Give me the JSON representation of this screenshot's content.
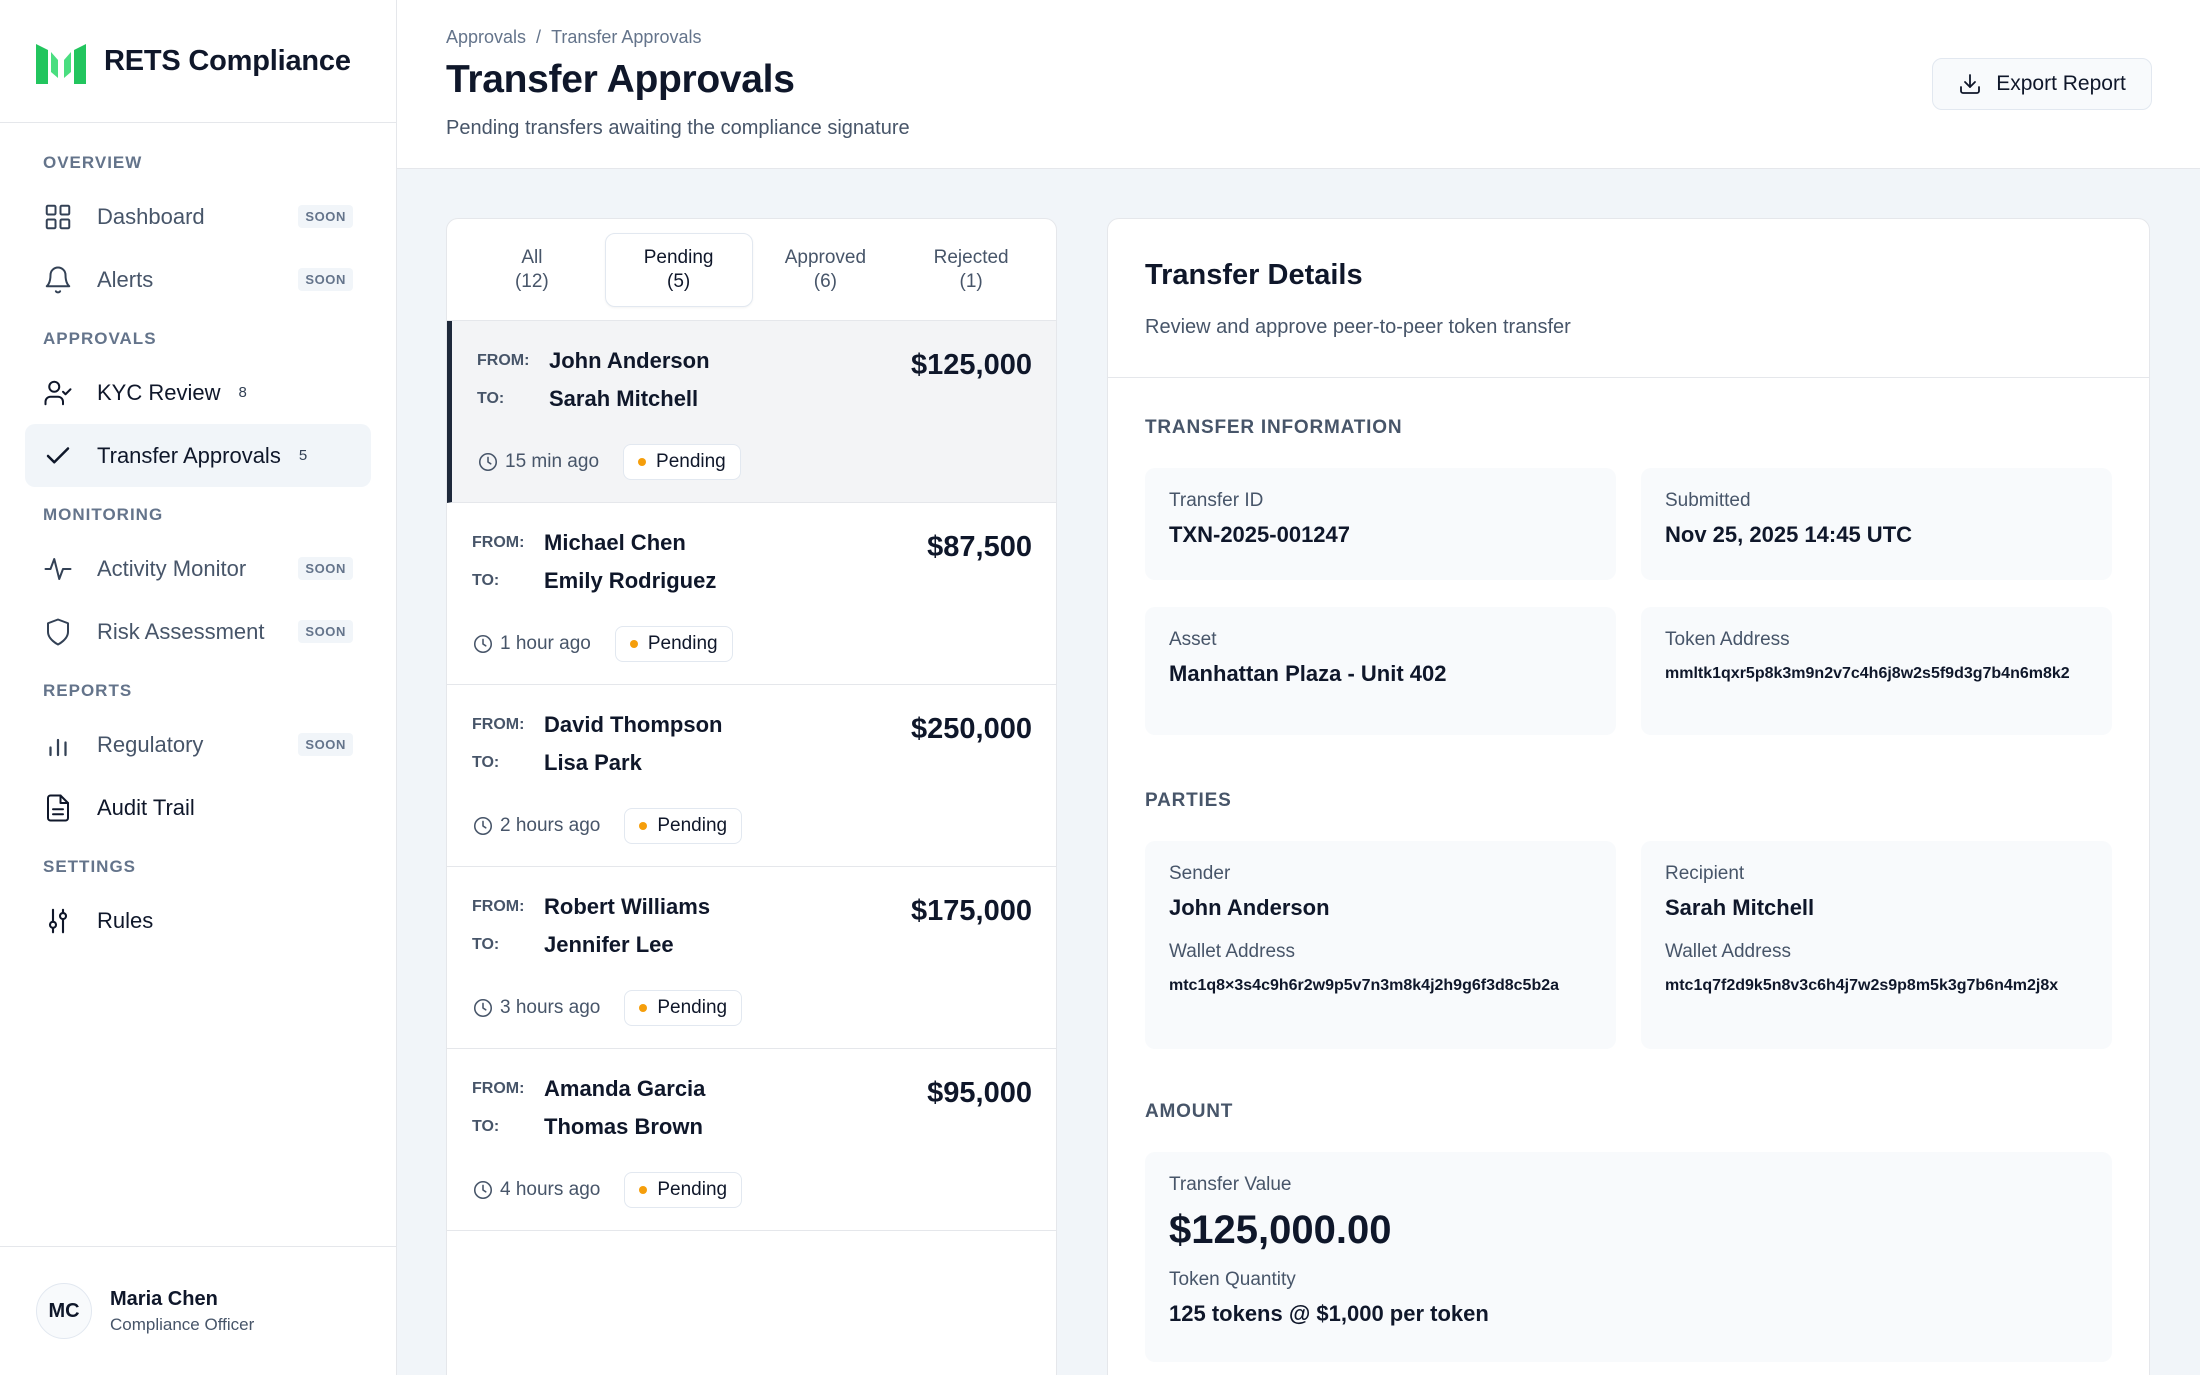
{
  "app": {
    "name": "RETS Compliance"
  },
  "colors": {
    "accent": "#22c55e",
    "pending": "#f59e0b",
    "active_bar": "#1e293b"
  },
  "sidebar": {
    "sections": [
      {
        "heading": "OVERVIEW",
        "items": [
          {
            "label": "Dashboard",
            "icon": "grid-icon",
            "badge": "SOON"
          },
          {
            "label": "Alerts",
            "icon": "bell-icon",
            "badge": "SOON"
          }
        ]
      },
      {
        "heading": "APPROVALS",
        "items": [
          {
            "label": "KYC Review",
            "icon": "user-check-icon",
            "count": "8"
          },
          {
            "label": "Transfer Approvals",
            "icon": "check-icon",
            "count": "5"
          }
        ]
      },
      {
        "heading": "MONITORING",
        "items": [
          {
            "label": "Activity Monitor",
            "icon": "activity-icon",
            "badge": "SOON"
          },
          {
            "label": "Risk Assessment",
            "icon": "shield-icon",
            "badge": "SOON"
          }
        ]
      },
      {
        "heading": "REPORTS",
        "items": [
          {
            "label": "Regulatory",
            "icon": "bar-chart-icon",
            "badge": "SOON"
          },
          {
            "label": "Audit Trail",
            "icon": "file-text-icon"
          }
        ]
      },
      {
        "heading": "SETTINGS",
        "items": [
          {
            "label": "Rules",
            "icon": "sliders-icon"
          }
        ]
      }
    ],
    "user": {
      "initials": "MC",
      "name": "Maria Chen",
      "role": "Compliance Officer"
    }
  },
  "header": {
    "breadcrumb": [
      "Approvals",
      "/",
      "Transfer Approvals"
    ],
    "title": "Transfer Approvals",
    "subtitle": "Pending transfers awaiting the compliance signature",
    "export_label": "Export Report"
  },
  "tabs": [
    {
      "label": "All",
      "count": "(12)"
    },
    {
      "label": "Pending",
      "count": "(5)"
    },
    {
      "label": "Approved",
      "count": "(6)"
    },
    {
      "label": "Rejected",
      "count": "(1)"
    }
  ],
  "list": {
    "from_key": "FROM:",
    "to_key": "TO:",
    "transfers": [
      {
        "from": "John Anderson",
        "to": "Sarah Mitchell",
        "amount": "$125,000",
        "time": "15 min ago",
        "status": "Pending"
      },
      {
        "from": "Michael Chen",
        "to": "Emily Rodriguez",
        "amount": "$87,500",
        "time": "1 hour ago",
        "status": "Pending"
      },
      {
        "from": "David Thompson",
        "to": "Lisa Park",
        "amount": "$250,000",
        "time": "2 hours ago",
        "status": "Pending"
      },
      {
        "from": "Robert Williams",
        "to": "Jennifer Lee",
        "amount": "$175,000",
        "time": "3 hours ago",
        "status": "Pending"
      },
      {
        "from": "Amanda Garcia",
        "to": "Thomas Brown",
        "amount": "$95,000",
        "time": "4 hours ago",
        "status": "Pending"
      }
    ]
  },
  "details": {
    "title": "Transfer Details",
    "subtitle": "Review and approve peer-to-peer token transfer",
    "info_heading": "TRANSFER INFORMATION",
    "transfer_id_label": "Transfer ID",
    "transfer_id": "TXN-2025-001247",
    "submitted_label": "Submitted",
    "submitted": "Nov 25, 2025 14:45 UTC",
    "asset_label": "Asset",
    "asset": "Manhattan Plaza - Unit 402",
    "token_address_label": "Token Address",
    "token_address": "mmltk1qxr5p8k3m9n2v7c4h6j8w2s5f9d3g7b4n6m8k2",
    "parties_heading": "PARTIES",
    "sender_label": "Sender",
    "sender": "John Anderson",
    "sender_wallet_label": "Wallet Address",
    "sender_wallet": "mtc1q8×3s4c9h6r2w9p5v7n3m8k4j2h9g6f3d8c5b2a",
    "recipient_label": "Recipient",
    "recipient": "Sarah Mitchell",
    "recipient_wallet_label": "Wallet Address",
    "recipient_wallet": "mtc1q7f2d9k5n8v3c6h4j7w2s9p8m5k3g7b6n4m2j8x",
    "amount_heading": "AMOUNT",
    "transfer_value_label": "Transfer Value",
    "transfer_value": "$125,000.00",
    "token_quantity_label": "Token Quantity",
    "token_quantity": "125 tokens @ $1,000 per token"
  }
}
